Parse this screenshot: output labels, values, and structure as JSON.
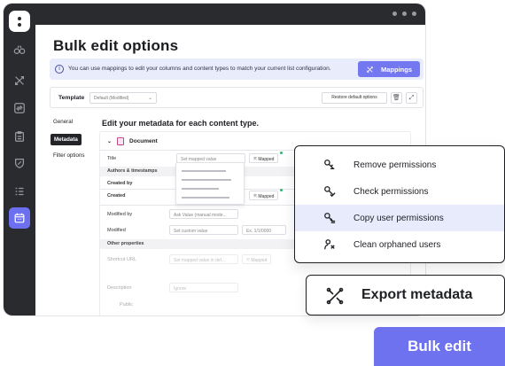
{
  "page": {
    "title": "Bulk edit options",
    "info_text": "You can use mappings to edit your columns and content types to match your current list configuration.",
    "mappings_label": "Mappings",
    "template_label": "Template",
    "template_value": "Default (Modified)",
    "restore_label": "Restore default options",
    "section_title": "Edit your metadata for each content type."
  },
  "left_nav": [
    {
      "label": "General"
    },
    {
      "label": "Metadata"
    },
    {
      "label": "Filter options"
    }
  ],
  "document": {
    "header": "Document",
    "rows": {
      "title_label": "Title",
      "title_field": "Set mapped value",
      "mapped_label": "Mapped",
      "authors_band": "Authors & timestamps",
      "created_by_label": "Created by",
      "created_label": "Created",
      "modified_by_label": "Modified by",
      "modified_by_field": "Ask Value (manual mode...",
      "modified_label": "Modified",
      "modified_field": "Set custom value",
      "modified_date": "Ex. 1/1/0000",
      "other_band": "Other properties",
      "shortcut_label": "Shortcut URL",
      "shortcut_field": "Set mapped value in def...",
      "description_label": "Description",
      "description_field": "Ignore",
      "public_label": "Public"
    }
  },
  "permissions_menu": [
    {
      "label": "Remove permissions",
      "icon": "key-minus-icon"
    },
    {
      "label": "Check permissions",
      "icon": "key-check-icon"
    },
    {
      "label": "Copy user permissions",
      "icon": "key-copy-icon"
    },
    {
      "label": "Clean orphaned users",
      "icon": "user-clean-icon"
    }
  ],
  "export": {
    "label": "Export metadata",
    "icon": "export-arrows-icon"
  },
  "bulk_edit": {
    "label": "Bulk edit"
  },
  "colors": {
    "accent": "#6e72ef",
    "sidebar": "#2a2b2f",
    "info_bg": "#e8ecfb",
    "highlight": "#e7ebfb"
  }
}
